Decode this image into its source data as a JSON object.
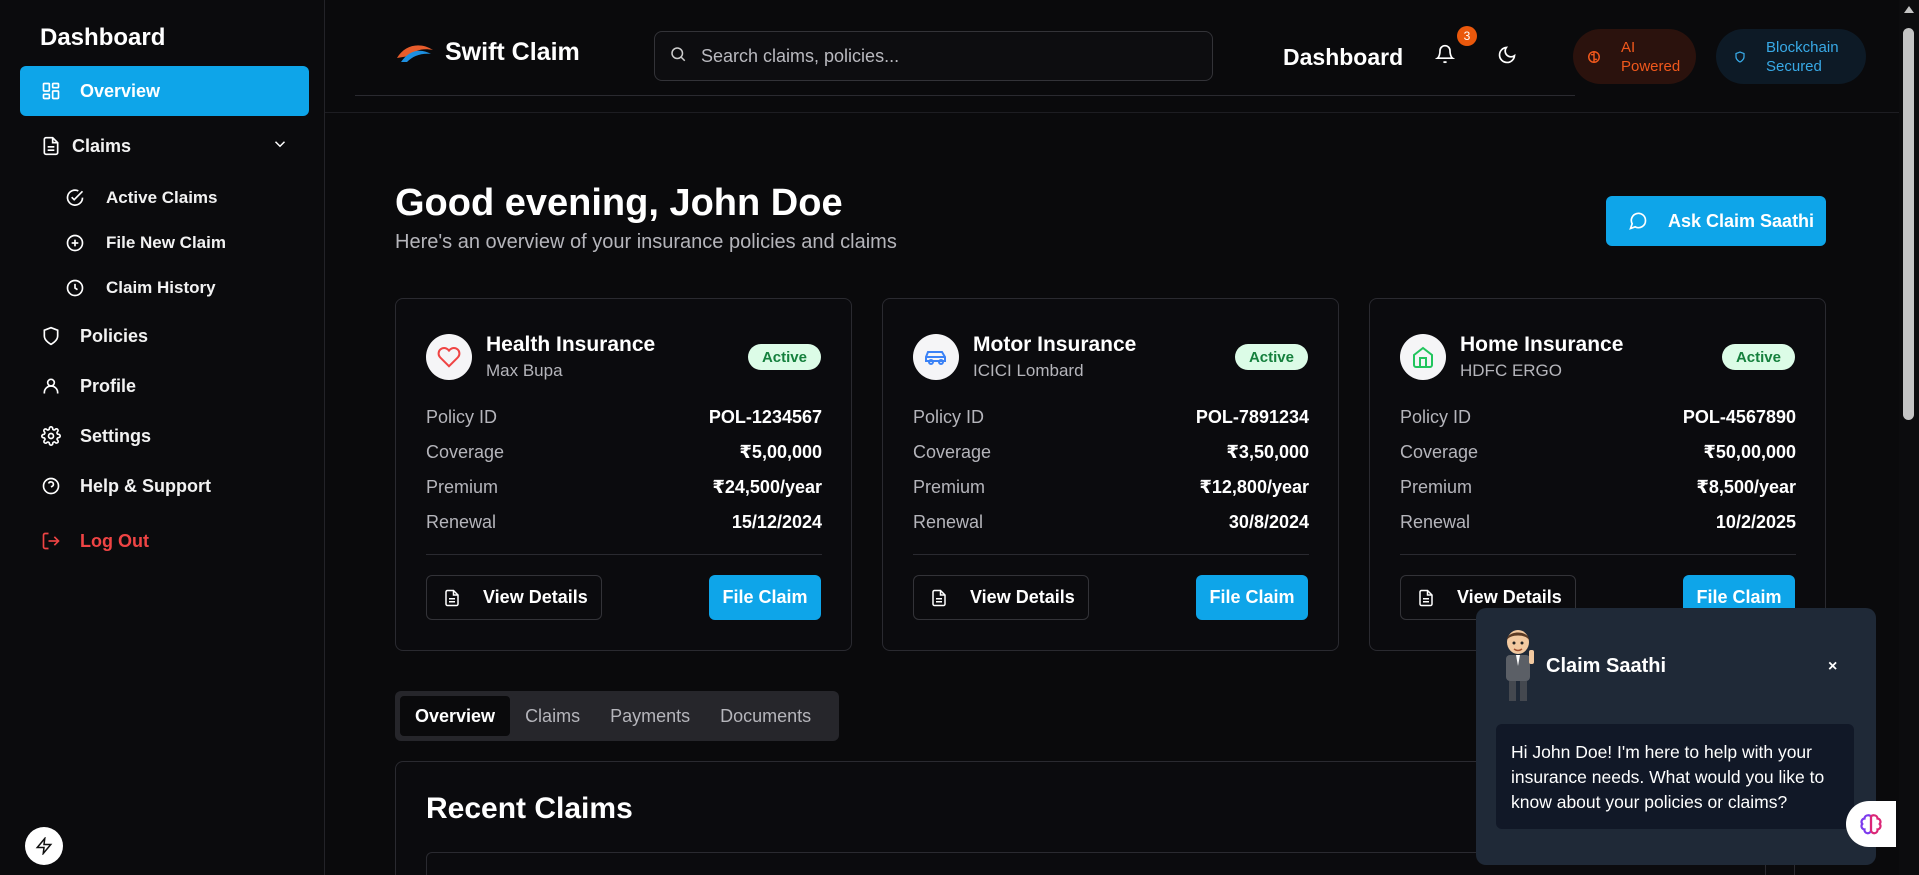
{
  "sidebar": {
    "title": "Dashboard",
    "items": {
      "overview": "Overview",
      "claims": "Claims",
      "active_claims": "Active Claims",
      "file_new_claim": "File New Claim",
      "claim_history": "Claim History",
      "policies": "Policies",
      "profile": "Profile",
      "settings": "Settings",
      "help": "Help & Support",
      "logout": "Log Out"
    }
  },
  "header": {
    "brand": "Swift Claim",
    "search_placeholder": "Search claims, policies...",
    "title": "Dashboard",
    "notification_count": "3",
    "ai_pill": [
      "AI",
      "Powered"
    ],
    "blockchain_pill": [
      "Blockchain",
      "Secured"
    ]
  },
  "main": {
    "greeting": "Good evening, John Doe",
    "subtitle": "Here's an overview of your insurance policies and claims",
    "ask_button": "Ask Claim Saathi",
    "labels": {
      "policy_id": "Policy ID",
      "coverage": "Coverage",
      "premium": "Premium",
      "renewal": "Renewal",
      "view_details": "View Details",
      "file_claim": "File Claim"
    },
    "cards": [
      {
        "title": "Health Insurance",
        "provider": "Max Bupa",
        "status": "Active",
        "policy_id": "POL-1234567",
        "coverage": "₹5,00,000",
        "premium": "₹24,500/year",
        "renewal": "15/12/2024",
        "icon": "heart-icon"
      },
      {
        "title": "Motor Insurance",
        "provider": "ICICI Lombard",
        "status": "Active",
        "policy_id": "POL-7891234",
        "coverage": "₹3,50,000",
        "premium": "₹12,800/year",
        "renewal": "30/8/2024",
        "icon": "car-icon"
      },
      {
        "title": "Home Insurance",
        "provider": "HDFC ERGO",
        "status": "Active",
        "policy_id": "POL-4567890",
        "coverage": "₹50,00,000",
        "premium": "₹8,500/year",
        "renewal": "10/2/2025",
        "icon": "home-icon"
      }
    ],
    "tabs": [
      "Overview",
      "Claims",
      "Payments",
      "Documents"
    ],
    "recent_title": "Recent Claims"
  },
  "chat": {
    "title": "Claim Saathi",
    "close": "×",
    "message": "Hi John Doe! I'm here to help with your insurance needs. What would you like to know about your policies or claims?"
  },
  "colors": {
    "accent": "#0ea5e9",
    "active_bg": "#dcfce7",
    "active_text": "#15803d",
    "logout": "#ef4444"
  }
}
